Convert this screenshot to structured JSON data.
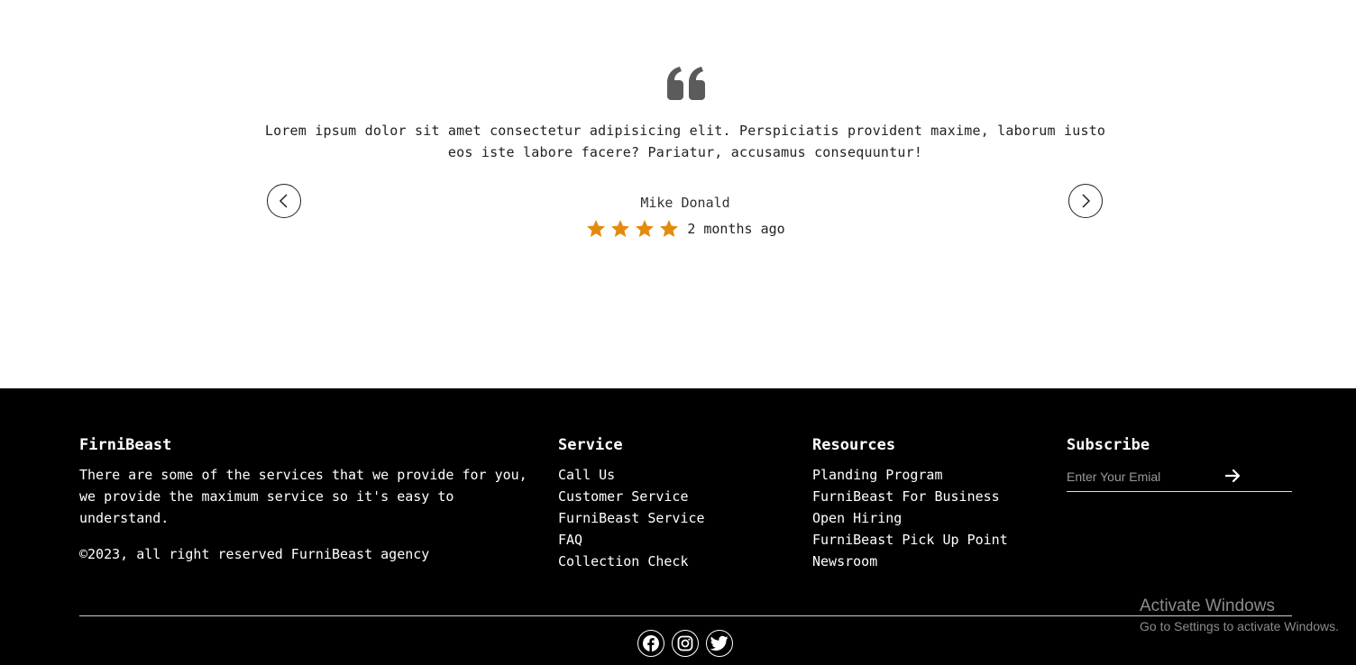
{
  "testimonial": {
    "quote_icon": "quote-icon",
    "text": "Lorem ipsum dolor sit amet consectetur adipisicing elit. Perspiciatis provident maxime, laborum iusto eos iste labore facere? Pariatur, accusamus consequuntur!",
    "author": "Mike Donald",
    "rating": 4,
    "rating_max": 4,
    "time_ago": "2 months ago",
    "star_color": "#e38b0e",
    "prev_icon": "chevron-left-icon",
    "next_icon": "chevron-right-icon"
  },
  "footer": {
    "background": "#000000",
    "brand": {
      "title": "FirniBeast",
      "description": "There are some of the services that we provide for you, we provide the maximum service so it's easy to understand.",
      "copyright": "©2023, all right reserved FurniBeast agency"
    },
    "service": {
      "title": "Service",
      "links": [
        "Call Us",
        "Customer Service",
        "FurniBeast Service",
        "FAQ",
        "Collection Check"
      ]
    },
    "resources": {
      "title": "Resources",
      "links": [
        "Planding Program",
        "FurniBeast For Business",
        "Open Hiring",
        "FurniBeast Pick Up Point",
        "Newsroom"
      ]
    },
    "subscribe": {
      "title": "Subscribe",
      "placeholder": "Enter Your Emial",
      "submit_icon": "arrow-right-icon"
    },
    "socials": [
      "facebook-icon",
      "instagram-icon",
      "twitter-icon"
    ]
  },
  "watermark": {
    "title": "Activate Windows",
    "subtitle": "Go to Settings to activate Windows."
  }
}
